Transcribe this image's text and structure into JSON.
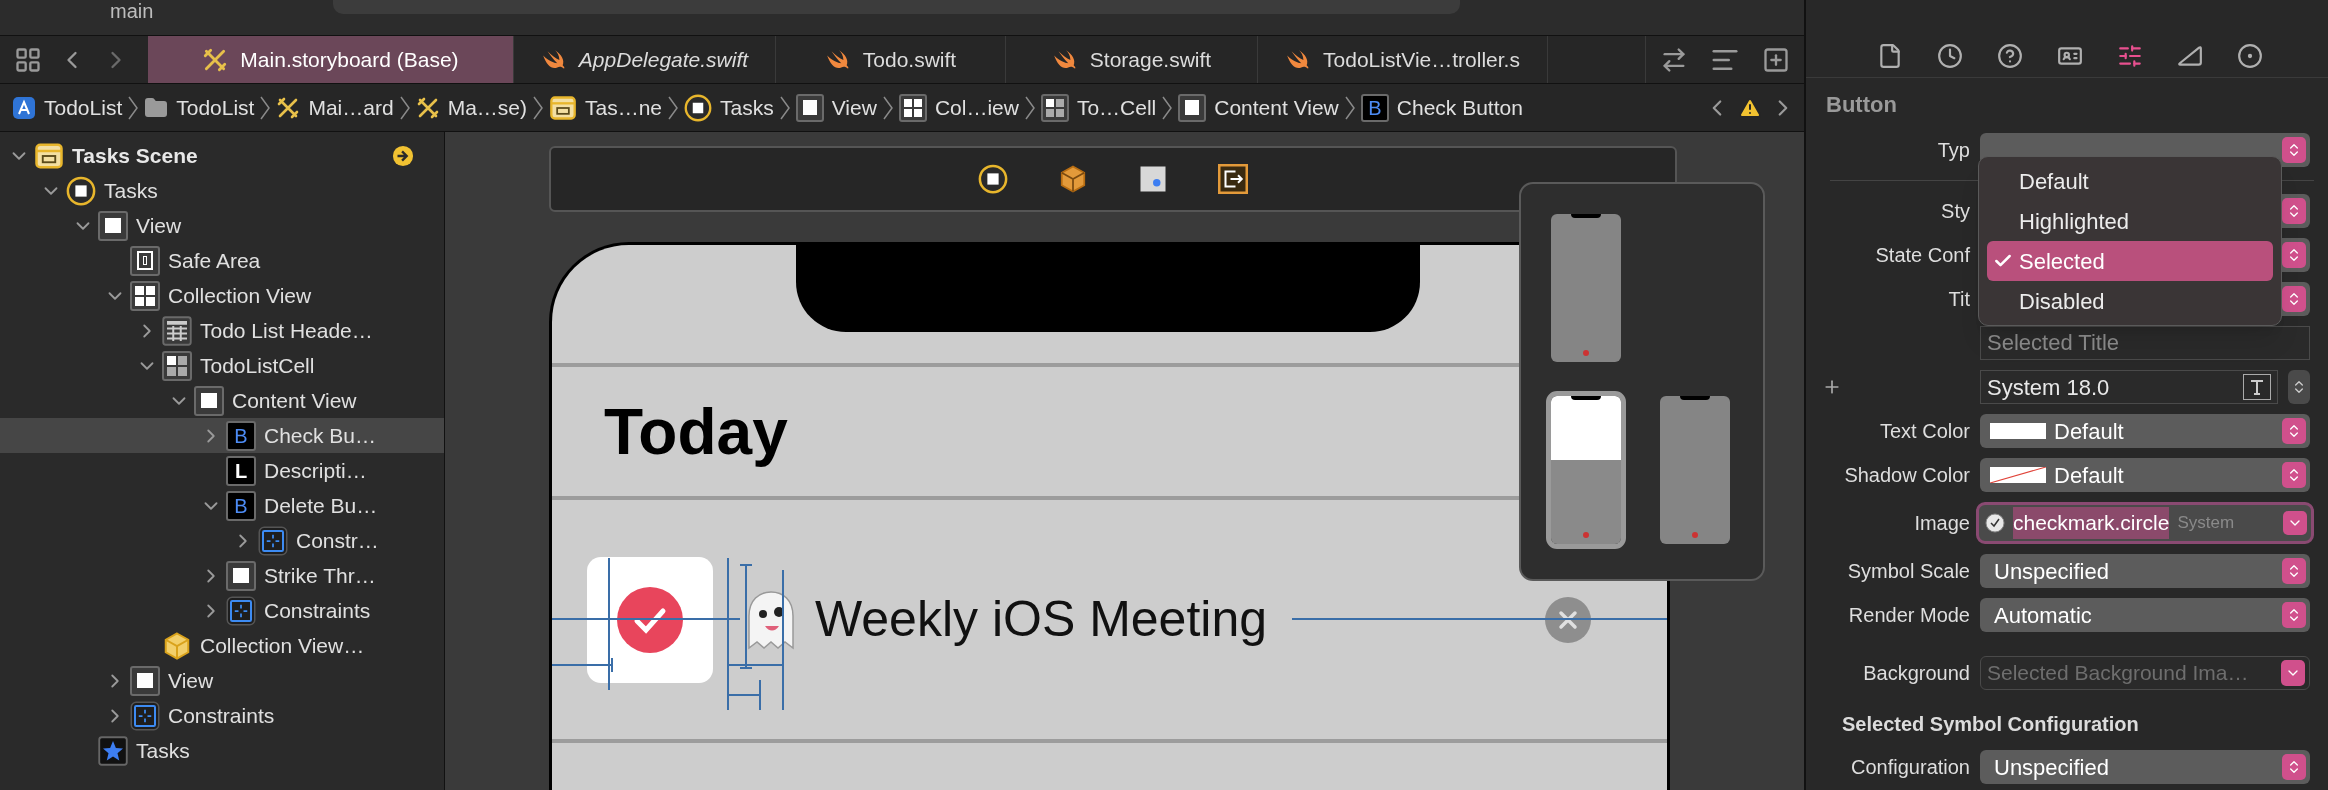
{
  "toolbar": {
    "branch": "main"
  },
  "tabs": [
    {
      "label": "Main.storyboard (Base)",
      "kind": "storyboard",
      "selected": true,
      "italic": false
    },
    {
      "label": "AppDelegate.swift",
      "kind": "swift",
      "selected": false,
      "italic": true
    },
    {
      "label": "Todo.swift",
      "kind": "swift",
      "selected": false,
      "italic": false
    },
    {
      "label": "Storage.swift",
      "kind": "swift",
      "selected": false,
      "italic": false
    },
    {
      "label": "TodoListVie…troller.s",
      "kind": "swift",
      "selected": false,
      "italic": false
    }
  ],
  "breadcrumbs": [
    {
      "label": "TodoList",
      "kind": "app"
    },
    {
      "label": "TodoList",
      "kind": "folder"
    },
    {
      "label": "Mai…ard",
      "kind": "storyboard"
    },
    {
      "label": "Ma…se)",
      "kind": "storyboard"
    },
    {
      "label": "Tas…ne",
      "kind": "scene"
    },
    {
      "label": "Tasks",
      "kind": "controller"
    },
    {
      "label": "View",
      "kind": "view"
    },
    {
      "label": "Col…iew",
      "kind": "collection"
    },
    {
      "label": "To…Cell",
      "kind": "cell"
    },
    {
      "label": "Content View",
      "kind": "view"
    },
    {
      "label": "Check Button",
      "kind": "button",
      "glyph": "B"
    }
  ],
  "outline": [
    {
      "label": "Tasks Scene",
      "kind": "scene",
      "expandable": true,
      "expanded": true,
      "selected": false,
      "children": [
        {
          "label": "Tasks",
          "kind": "controller",
          "expandable": true,
          "expanded": true,
          "selected": false,
          "children": [
            {
              "label": "View",
              "kind": "view",
              "expandable": true,
              "expanded": true,
              "selected": false,
              "children": [
                {
                  "label": "Safe Area",
                  "kind": "safearea",
                  "expandable": false,
                  "selected": false
                },
                {
                  "label": "Collection View",
                  "kind": "collection",
                  "expandable": true,
                  "expanded": true,
                  "selected": false,
                  "children": [
                    {
                      "label": "Todo List Heade…",
                      "kind": "header",
                      "expandable": true,
                      "expanded": false,
                      "selected": false
                    },
                    {
                      "label": "TodoListCell",
                      "kind": "cell",
                      "expandable": true,
                      "expanded": true,
                      "selected": false,
                      "children": [
                        {
                          "label": "Content View",
                          "kind": "view",
                          "expandable": true,
                          "expanded": true,
                          "selected": false,
                          "children": [
                            {
                              "label": "Check Bu…",
                              "kind": "button",
                              "glyph": "B",
                              "expandable": true,
                              "expanded": false,
                              "selected": true
                            },
                            {
                              "label": "Descripti…",
                              "kind": "label",
                              "glyph": "L",
                              "expandable": false,
                              "selected": false
                            },
                            {
                              "label": "Delete Bu…",
                              "kind": "button",
                              "glyph": "B",
                              "expandable": true,
                              "expanded": true,
                              "selected": false,
                              "children": [
                                {
                                  "label": "Constr…",
                                  "kind": "constraints",
                                  "expandable": true,
                                  "expanded": false,
                                  "selected": false
                                }
                              ]
                            },
                            {
                              "label": "Strike Thr…",
                              "kind": "view",
                              "expandable": true,
                              "expanded": false,
                              "selected": false
                            },
                            {
                              "label": "Constraints",
                              "kind": "constraints",
                              "expandable": true,
                              "expanded": false,
                              "selected": false
                            }
                          ]
                        }
                      ]
                    },
                    {
                      "label": "Collection View…",
                      "kind": "cube",
                      "expandable": false,
                      "selected": false
                    }
                  ]
                },
                {
                  "label": "View",
                  "kind": "view",
                  "expandable": true,
                  "expanded": false,
                  "selected": false
                },
                {
                  "label": "Constraints",
                  "kind": "constraints",
                  "expandable": true,
                  "expanded": false,
                  "selected": false
                }
              ]
            },
            {
              "label": "Tasks",
              "kind": "star",
              "expandable": false,
              "selected": false
            }
          ]
        }
      ]
    }
  ],
  "canvas": {
    "screen_title": "Today",
    "cell": {
      "checked": true,
      "text": "Weekly iOS Meeting"
    },
    "device_previews": [
      {
        "selected": false
      },
      {
        "selected": true
      },
      {
        "selected": false
      }
    ]
  },
  "inspector": {
    "tabs": [
      {
        "kind": "file",
        "selected": false
      },
      {
        "kind": "history",
        "selected": false
      },
      {
        "kind": "help",
        "selected": false
      },
      {
        "kind": "identity",
        "selected": false
      },
      {
        "kind": "attributes",
        "selected": true
      },
      {
        "kind": "size",
        "selected": false
      },
      {
        "kind": "connections",
        "selected": false
      }
    ],
    "section": "Button",
    "rows": [
      {
        "label": "Typ",
        "kind": "popup"
      },
      {
        "label": "Sty",
        "kind": "popup"
      },
      {
        "label": "State Conf",
        "kind": "popup"
      },
      {
        "label": "Tit",
        "kind": "popup"
      },
      {
        "kind": "text",
        "placeholder": "Selected Title"
      },
      {
        "kind": "font",
        "value": "System 18.0"
      },
      {
        "label": "Text Color",
        "kind": "color",
        "clear": false,
        "value": "Default"
      },
      {
        "label": "Shadow Color",
        "kind": "color",
        "clear": true,
        "value": "Default"
      },
      {
        "label": "Image",
        "kind": "image",
        "value": "checkmark.circle",
        "note": "System",
        "focused": true
      },
      {
        "label": "Symbol Scale",
        "kind": "popup",
        "value": "Unspecified"
      },
      {
        "label": "Render Mode",
        "kind": "popup",
        "value": "Automatic"
      },
      {
        "label": "Background",
        "kind": "combo",
        "placeholder": "Selected Background Ima…"
      },
      {
        "label": "Selected Symbol Configuration",
        "kind": "heading"
      },
      {
        "label": "Configuration",
        "kind": "popup",
        "value": "Unspecified"
      }
    ],
    "menu": [
      {
        "label": "Default",
        "selected": false
      },
      {
        "label": "Highlighted",
        "selected": false
      },
      {
        "label": "Selected",
        "selected": true
      },
      {
        "label": "Disabled",
        "selected": false
      }
    ]
  }
}
